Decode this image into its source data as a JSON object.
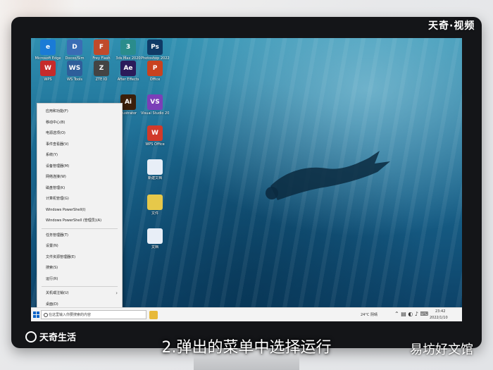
{
  "watermark": "天奇·视频",
  "logo_text": "天奇生活",
  "caption": "2.弹出的菜单中选择运行",
  "brand": "易坊好文馆",
  "desktop_icons": [
    {
      "label": "Microsoft Edge",
      "glyph": "e",
      "color": "#1a7bd6"
    },
    {
      "label": "Docoo/Sim",
      "glyph": "D",
      "color": "#3a6db5"
    },
    {
      "label": "Frey Flash",
      "glyph": "F",
      "color": "#c04a2b"
    },
    {
      "label": "3ds Max 2020",
      "glyph": "3",
      "color": "#2a8c8c"
    },
    {
      "label": "Photoshop 2022",
      "glyph": "Ps",
      "color": "#0f3a66"
    },
    {
      "label": "WPS",
      "glyph": "W",
      "color": "#c62b2b"
    },
    {
      "label": "WS Tools",
      "glyph": "WS",
      "color": "#2e5e9a"
    },
    {
      "label": "ZTE IO",
      "glyph": "Z",
      "color": "#444"
    },
    {
      "label": "After Effects",
      "glyph": "Ae",
      "color": "#2b1b5a"
    },
    {
      "label": "Office",
      "glyph": "P",
      "color": "#c9421f"
    },
    {
      "label": "Visual Studio 2019",
      "glyph": "VS",
      "color": "#7b3fb8"
    },
    {
      "label": "WPS Office",
      "glyph": "W",
      "color": "#d13a2a"
    },
    {
      "label": "Illustrator",
      "glyph": "Ai",
      "color": "#3b1f0a"
    },
    {
      "label": "新建文档",
      "glyph": "",
      "color": "#e8eef7"
    },
    {
      "label": "文件",
      "glyph": "",
      "color": "#e6c84a"
    },
    {
      "label": "文档",
      "glyph": "",
      "color": "#e8eef7"
    }
  ],
  "context_menu": [
    {
      "label": "应用和功能(F)"
    },
    {
      "label": "移动中心(B)"
    },
    {
      "label": "电源选项(O)"
    },
    {
      "label": "事件查看器(V)"
    },
    {
      "label": "系统(Y)"
    },
    {
      "label": "设备管理器(M)"
    },
    {
      "label": "网络连接(W)"
    },
    {
      "label": "磁盘管理(K)"
    },
    {
      "label": "计算机管理(G)"
    },
    {
      "label": "Windows PowerShell(I)"
    },
    {
      "label": "Windows PowerShell (管理员)(A)"
    },
    {
      "label": "任务管理器(T)"
    },
    {
      "label": "设置(N)"
    },
    {
      "label": "文件资源管理器(E)"
    },
    {
      "label": "搜索(S)"
    },
    {
      "label": "运行(R)"
    },
    {
      "label": "关机或注销(U)"
    },
    {
      "label": "桌面(D)"
    }
  ],
  "taskbar": {
    "search_placeholder": "在这里输入你要搜索的内容",
    "weather": "24°C 阴晴",
    "time": "23:42",
    "date": "2022/1/10"
  }
}
